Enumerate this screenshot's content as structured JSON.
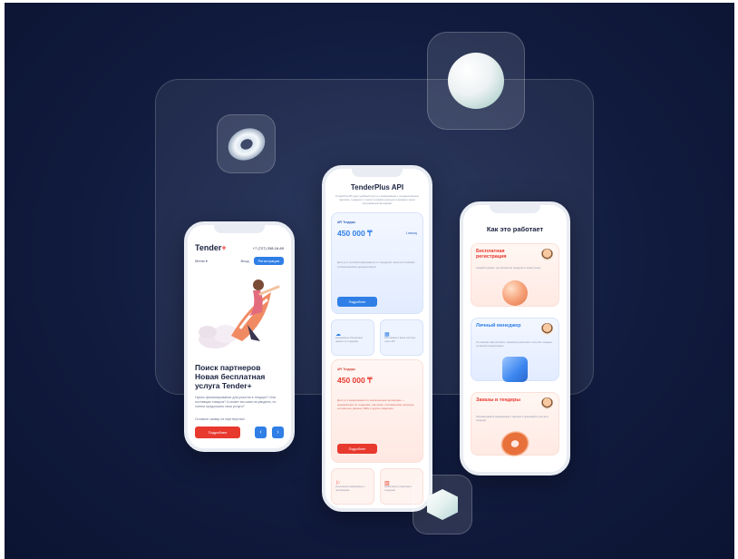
{
  "phone1": {
    "logo": "Tender",
    "logo_plus": "+",
    "phone_number": "+7 (727) 338-16-69",
    "menu_label": "Меню ▾",
    "login_label": "Вход",
    "register_label": "Регистрация",
    "title": "Поиск партнеров Новая бесплатная услуга Tender+",
    "text": "Нужно финансирование для участия в тендере? Или поставщик товаров? А может вы сами на увидели, но хотели предложить свои услуги?",
    "text2": "Оставьте заявку на партнерство!",
    "more_label": "Подробнее",
    "prev_label": "‹",
    "next_label": "›"
  },
  "phone2": {
    "title": "TenderPlus API",
    "subtitle": "TenderPlus API дает удобный доступ к информации о государственных закупках, тендерах и торгах в режиме реального времени через программный интерфейс",
    "card1": {
      "label": "API Тендеры",
      "period": "1 месяц",
      "price": "450 000 ₸",
      "desc": "Доступ к полной информации по тендерам, всем источникам и изменениям в документации",
      "button": "Подробнее"
    },
    "mini1": [
      {
        "icon": "☁",
        "text": "Ежедневное обновление данных по тендерам"
      },
      {
        "icon": "▦",
        "text": "Интеграция в ваши системы через API"
      }
    ],
    "card2": {
      "label": "API Тендеры",
      "price": "450 000 ₸",
      "desc": "Доступ к информации по заключенным договорам — информация по тендерам, закупкам, поставщикам, включая контактные данные, БИН и другие сведения",
      "button": "Подробнее"
    },
    "mini2": [
      {
        "icon": "⚐",
        "text": "Актуальная информация о поставщиках"
      },
      {
        "icon": "▥",
        "text": "Аналитика по закупкам и тендерам"
      }
    ]
  },
  "phone3": {
    "title": "Как это работает",
    "steps": [
      {
        "title": "Бесплатная регистрация",
        "text": "Создайте аккаунт для просмотра тендеров по всему рынку"
      },
      {
        "title": "Личный менеджер",
        "text": "Он поможет вам настроить параметры рассылки и получать тендеры по вашей специализации"
      },
      {
        "title": "Заказы и тендеры",
        "text": "Просматривайте информацию о закупках и принимайте участие в тендерах"
      }
    ]
  }
}
